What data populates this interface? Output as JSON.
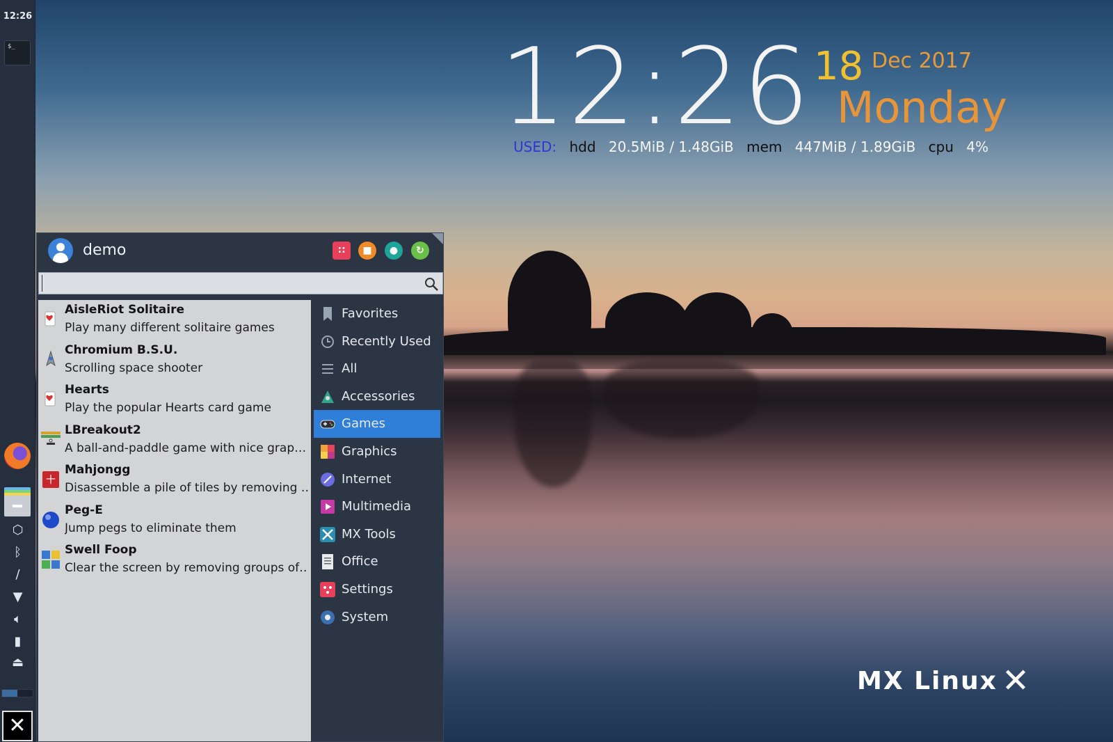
{
  "panel": {
    "clock": "12:26",
    "terminal_label": "$_"
  },
  "conky": {
    "time": "12:26",
    "day": "18",
    "month_year": "Dec 2017",
    "weekday": "Monday",
    "used_label": "USED:",
    "hdd_label": "hdd",
    "hdd_value": "20.5MiB / 1.48GiB",
    "mem_label": "mem",
    "mem_value": "447MiB / 1.89GiB",
    "cpu_label": "cpu",
    "cpu_value": "4%"
  },
  "logo": {
    "text": "MX Linux"
  },
  "menu": {
    "username": "demo",
    "search": {
      "value": "",
      "placeholder": ""
    },
    "apps": [
      {
        "name": "AisleRiot Solitaire",
        "desc": "Play many different solitaire games",
        "icon": "cards-icon"
      },
      {
        "name": "Chromium B.S.U.",
        "desc": "Scrolling space shooter",
        "icon": "spaceship-icon"
      },
      {
        "name": "Hearts",
        "desc": "Play the popular Hearts card game",
        "icon": "cards-icon"
      },
      {
        "name": "LBreakout2",
        "desc": "A ball-and-paddle game with nice grap…",
        "icon": "breakout-icon"
      },
      {
        "name": "Mahjongg",
        "desc": "Disassemble a pile of tiles by removing …",
        "icon": "mahjongg-icon"
      },
      {
        "name": "Peg-E",
        "desc": "Jump pegs to eliminate them",
        "icon": "peg-icon"
      },
      {
        "name": "Swell Foop",
        "desc": "Clear the screen by removing groups of…",
        "icon": "swellfoop-icon"
      }
    ],
    "categories": [
      {
        "label": "Favorites",
        "icon": "bookmark-icon"
      },
      {
        "label": "Recently Used",
        "icon": "clock-icon"
      },
      {
        "label": "All",
        "icon": "list-icon"
      },
      {
        "label": "Accessories",
        "icon": "accessories-icon"
      },
      {
        "label": "Games",
        "icon": "gamepad-icon",
        "active": true
      },
      {
        "label": "Graphics",
        "icon": "graphics-icon"
      },
      {
        "label": "Internet",
        "icon": "globe-icon"
      },
      {
        "label": "Multimedia",
        "icon": "multimedia-icon"
      },
      {
        "label": "MX Tools",
        "icon": "tools-icon"
      },
      {
        "label": "Office",
        "icon": "document-icon"
      },
      {
        "label": "Settings",
        "icon": "settings-icon"
      },
      {
        "label": "System",
        "icon": "system-icon"
      }
    ]
  },
  "colors": {
    "accent": "#2f7fd8",
    "panel": "#252f3d",
    "menu_bg": "#2b3544",
    "list_bg": "#d3d4d6",
    "day_color": "#f0c030",
    "weekday_color": "#e8953a",
    "used_color": "#2f36d8"
  }
}
